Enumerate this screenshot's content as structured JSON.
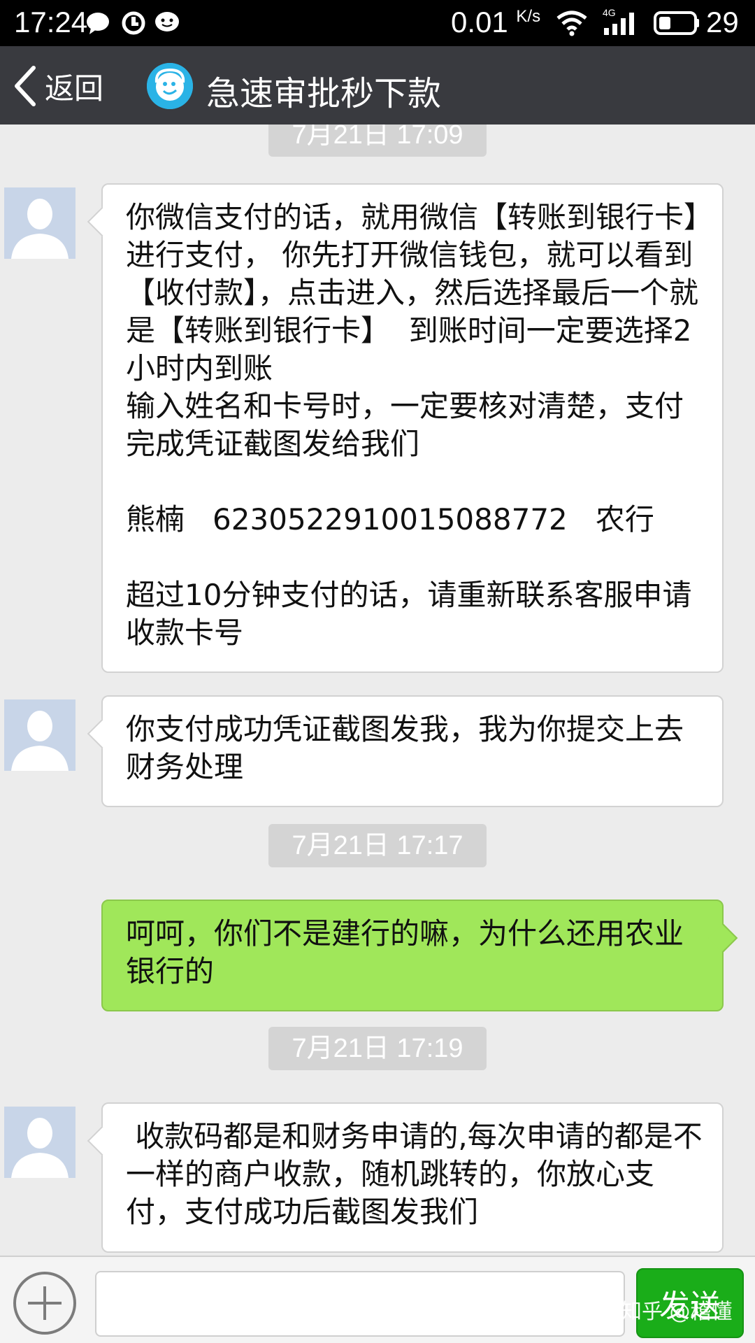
{
  "status_bar": {
    "time": "17:24",
    "speed": "0.01",
    "speed_unit": "K/s",
    "network": "4G",
    "battery": "29",
    "icons": [
      "chat-bubble-icon",
      "sync-icon",
      "messenger-icon",
      "wifi-icon",
      "signal-icon",
      "battery-icon"
    ]
  },
  "nav": {
    "back_label": "返回",
    "title": "急速审批秒下款"
  },
  "messages": [
    {
      "type": "timestamp",
      "text": "7月21日 17:09"
    },
    {
      "type": "incoming",
      "text": "你微信支付的话，就用微信【转账到银行卡】进行支付， 你先打开微信钱包，就可以看到【收付款】，点击进入，然后选择最后一个就是【转账到银行卡】  到账时间一定要选择2小时内到账\n输入姓名和卡号时，一定要核对清楚，支付完成凭证截图发给我们\n\n熊楠   6230522910015088772   农行\n\n超过10分钟支付的话，请重新联系客服申请收款卡号"
    },
    {
      "type": "incoming",
      "text": "你支付成功凭证截图发我，我为你提交上去财务处理"
    },
    {
      "type": "timestamp",
      "text": "7月21日 17:17"
    },
    {
      "type": "outgoing",
      "text": "呵呵，你们不是建行的嘛，为什么还用农业银行的"
    },
    {
      "type": "timestamp",
      "text": "7月21日 17:19"
    },
    {
      "type": "incoming",
      "text": " 收款码都是和财务申请的,每次申请的都是不一样的商户收款，随机跳转的，你放心支付，支付成功后截图发我们"
    }
  ],
  "input_bar": {
    "input_value": "",
    "send_label": "发送"
  },
  "watermark": "知乎 @稽懂",
  "colors": {
    "nav_bg": "#393a3f",
    "chat_bg": "#ececec",
    "outgoing_bubble": "#a0e75a",
    "send_button": "#1aad19"
  }
}
